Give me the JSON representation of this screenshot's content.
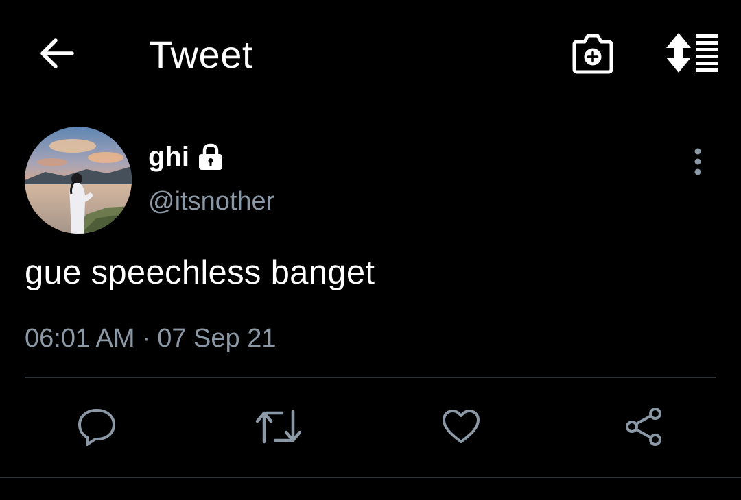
{
  "header": {
    "title": "Tweet",
    "back_icon": "arrow-left-icon",
    "camera_icon": "camera-plus-icon",
    "sort_icon": "sort-list-icon"
  },
  "tweet": {
    "display_name": "ghi",
    "protected_icon": "lock-icon",
    "handle": "@itsnother",
    "text": "gue speechless banget",
    "time": "06:01 AM",
    "separator": "·",
    "date": "07 Sep 21",
    "more_icon": "more-vertical-icon"
  },
  "actions": [
    {
      "icon": "reply-icon"
    },
    {
      "icon": "retweet-icon"
    },
    {
      "icon": "like-icon"
    },
    {
      "icon": "share-icon"
    }
  ],
  "colors": {
    "background": "#000000",
    "primary_text": "#ffffff",
    "secondary_text": "#8b98a5",
    "divider": "#2f3336"
  }
}
